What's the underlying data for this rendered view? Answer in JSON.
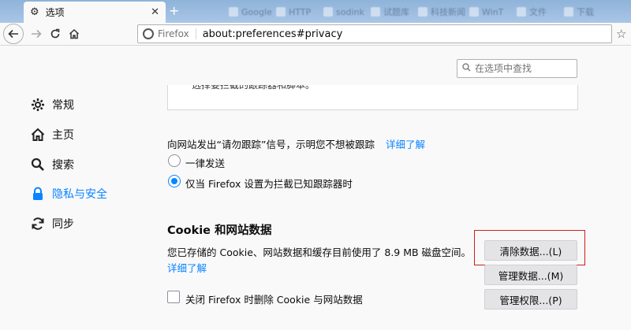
{
  "tabs": {
    "active_title": "选项",
    "background": [
      "Google",
      "HTTP",
      "sodink",
      "试题库",
      "科技新闻",
      "WinT",
      "文件",
      "下载"
    ]
  },
  "toolbar": {
    "url_identity": "Firefox",
    "url": "about:preferences#privacy"
  },
  "search": {
    "placeholder": "在选项中查找"
  },
  "sidebar": {
    "items": [
      {
        "label": "常规",
        "icon": "gear-icon"
      },
      {
        "label": "主页",
        "icon": "home-icon"
      },
      {
        "label": "搜索",
        "icon": "search-icon"
      },
      {
        "label": "隐私与安全",
        "icon": "lock-icon",
        "active": true
      },
      {
        "label": "同步",
        "icon": "sync-icon"
      }
    ]
  },
  "main": {
    "partial_text": "选择要拦截的跟踪器和脚本。",
    "dnt": {
      "text": "向网站发出“请勿跟踪”信号，示明您不想被跟踪",
      "learn_more": "详细了解",
      "option_always": "一律发送",
      "option_only_blocking": "仅当 Firefox 设置为拦截已知跟踪器时",
      "selected": "option_only_blocking"
    },
    "cookies": {
      "title": "Cookie 和网站数据",
      "usage_text": "您已存储的 Cookie、网站数据和缓存目前使用了 8.9 MB 磁盘空间。",
      "learn_more": "详细了解",
      "clear_button": "清除数据...(L)",
      "manage_button": "管理数据...(M)",
      "permissions_button": "管理权限...(P)",
      "delete_on_close": "关闭 Firefox 时删除 Cookie 与网站数据",
      "delete_on_close_checked": false
    }
  },
  "colors": {
    "accent": "#0a84ff",
    "highlight_box": "#c8201c"
  }
}
